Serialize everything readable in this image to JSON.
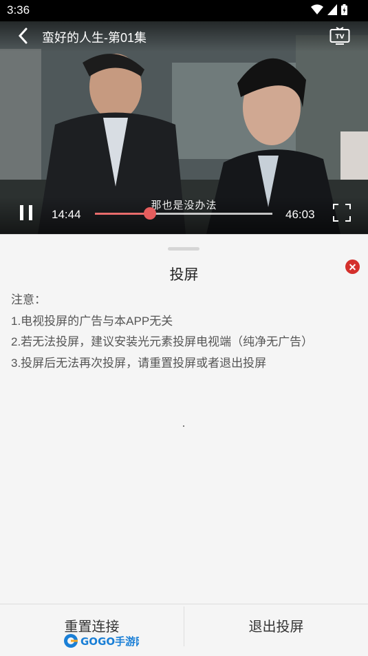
{
  "status_bar": {
    "time": "3:36"
  },
  "video": {
    "title": "蛮好的人生-第01集",
    "subtitle": "那也是没办法",
    "current_time": "14:44",
    "duration": "46:03",
    "progress": 0.31,
    "icons": {
      "back": "chevron-left-icon",
      "cast": "tv-icon",
      "play_state": "pause-icon",
      "fullscreen": "fullscreen-icon"
    },
    "accent_color": "#e55d5d"
  },
  "sheet": {
    "title": "投屏",
    "notes": [
      "注意：",
      "1.电视投屏的广告与本APP无关",
      "2.若无法投屏，建议安装光元素投屏电视端（纯净无广告）",
      "3.投屏后无法再次投屏，请重置投屏或者退出投屏"
    ],
    "close_color": "#d4302c"
  },
  "footer": {
    "reset_label": "重置连接",
    "exit_label": "退出投屏"
  },
  "watermark": {
    "text": "GOGO手游网"
  }
}
